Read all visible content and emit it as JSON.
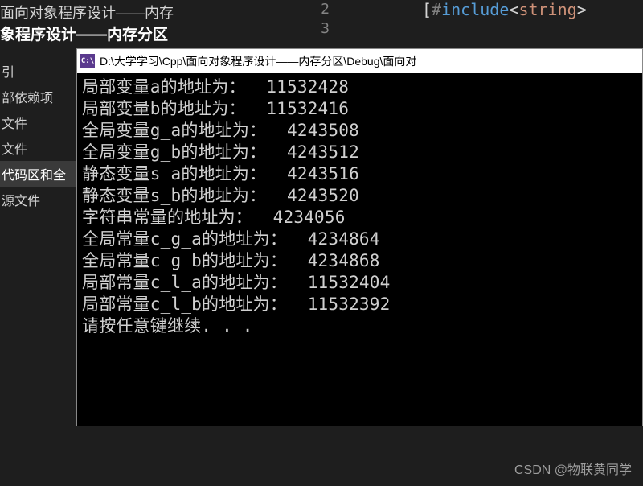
{
  "vs": {
    "header": "面向对象程序设计——内存",
    "subheader": "象程序设计——内存分区",
    "line_numbers": [
      "2",
      "3"
    ],
    "include_line": {
      "hash": "#",
      "keyword": "include",
      "lt": "<",
      "lib": "string",
      "gt": ">"
    }
  },
  "sidebar": {
    "items": [
      {
        "label": "引"
      },
      {
        "label": "部依赖项"
      },
      {
        "label": "文件"
      },
      {
        "label": "文件"
      },
      {
        "label": "代码区和全",
        "selected": true
      },
      {
        "label": "源文件"
      }
    ]
  },
  "console": {
    "icon_text": "C:\\",
    "title": "D:\\大学学习\\Cpp\\面向对象程序设计——内存分区\\Debug\\面向对",
    "lines": [
      "局部变量a的地址为：  11532428",
      "局部变量b的地址为：  11532416",
      "全局变量g_a的地址为：  4243508",
      "全局变量g_b的地址为：  4243512",
      "静态变量s_a的地址为：  4243516",
      "静态变量s_b的地址为：  4243520",
      "字符串常量的地址为：  4234056",
      "全局常量c_g_a的地址为：  4234864",
      "全局常量c_g_b的地址为：  4234868",
      "局部常量c_l_a的地址为：  11532404",
      "局部常量c_l_b的地址为：  11532392",
      "请按任意键继续. . ."
    ]
  },
  "watermark": "CSDN @物联黄同学"
}
